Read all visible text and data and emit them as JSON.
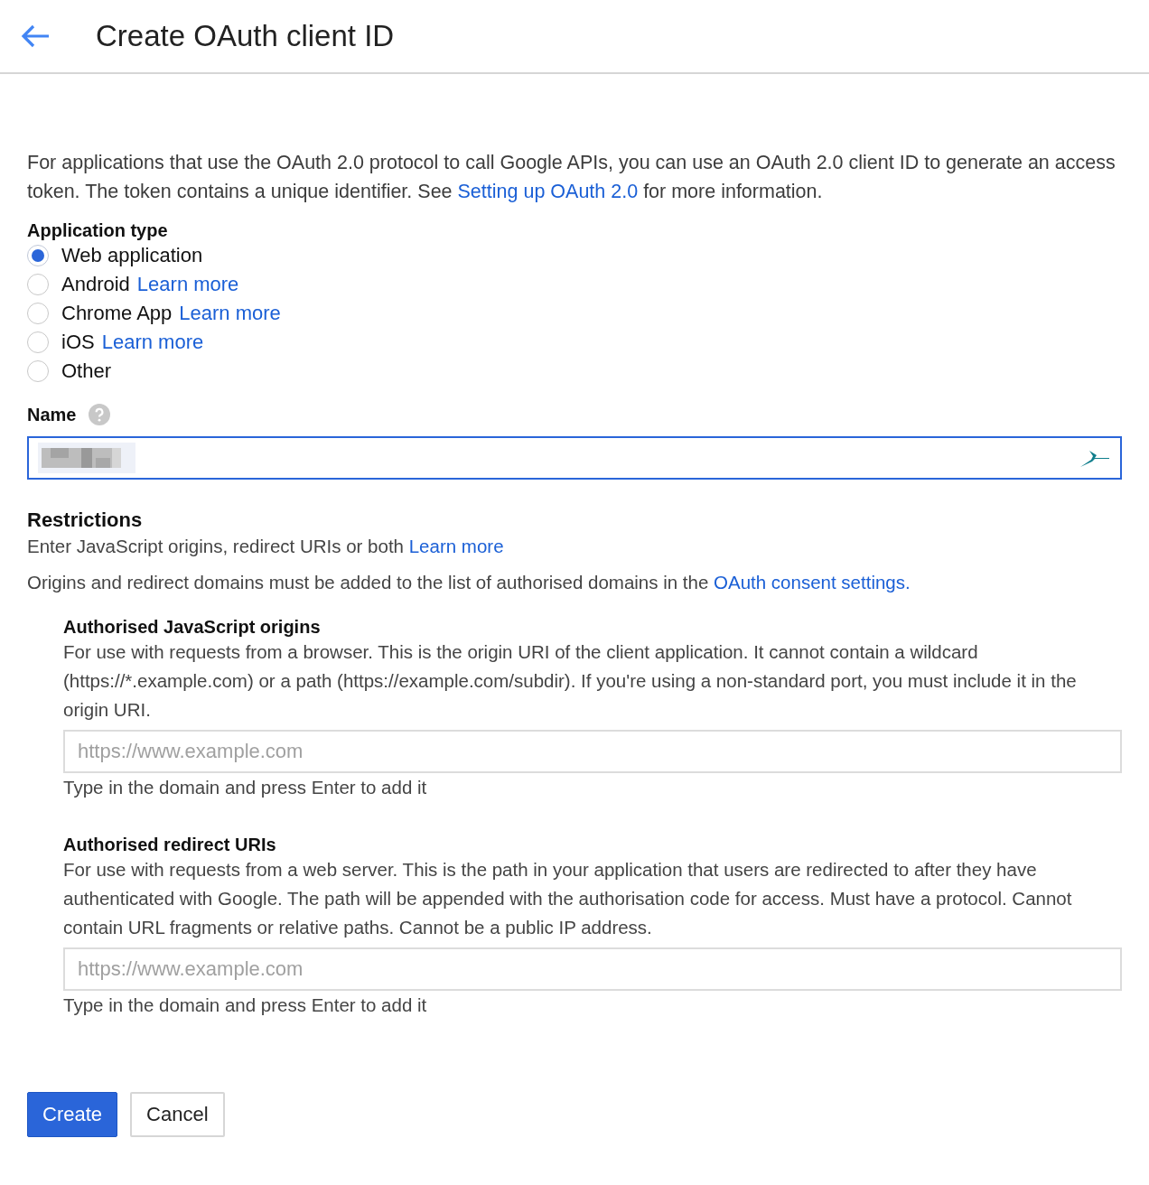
{
  "header": {
    "title": "Create OAuth client ID"
  },
  "intro": {
    "text": "For applications that use the OAuth 2.0 protocol to call Google APIs, you can use an OAuth 2.0 client ID to generate an access token. The token contains a unique identifier. See ",
    "link": "Setting up OAuth 2.0",
    "text_after": " for more information."
  },
  "application_type": {
    "label": "Application type",
    "options": [
      {
        "label": "Web application",
        "selected": true
      },
      {
        "label": "Android",
        "link": "Learn more",
        "selected": false
      },
      {
        "label": "Chrome App",
        "link": "Learn more",
        "selected": false
      },
      {
        "label": "iOS",
        "link": "Learn more",
        "selected": false
      },
      {
        "label": "Other",
        "selected": false
      }
    ]
  },
  "name": {
    "label": "Name",
    "value_redacted": true,
    "focused": true
  },
  "restrictions": {
    "title": "Restrictions",
    "description": "Enter JavaScript origins, redirect URIs or both ",
    "description_link": "Learn more",
    "note": "Origins and redirect domains must be added to the list of authorised domains in the ",
    "note_link": "OAuth consent settings."
  },
  "sections": [
    {
      "title": "Authorised JavaScript origins",
      "description": "For use with requests from a browser. This is the origin URI of the client application. It cannot contain a wildcard (https://*.example.com) or a path (https://example.com/subdir). If you're using a non-standard port, you must include it in the origin URI.",
      "placeholder": "https://www.example.com",
      "hint": "Type in the domain and press Enter to add it"
    },
    {
      "title": "Authorised redirect URIs",
      "description": "For use with requests from a web server. This is the path in your application that users are redirected to after they have authenticated with Google. The path will be appended with the authorisation code for access. Must have a protocol. Cannot contain URL fragments or relative paths. Cannot be a public IP address.",
      "placeholder": "https://www.example.com",
      "hint": "Type in the domain and press Enter to add it"
    }
  ],
  "buttons": [
    {
      "label": "Create",
      "kind": "primary"
    },
    {
      "label": "Cancel",
      "kind": "secondary"
    }
  ]
}
